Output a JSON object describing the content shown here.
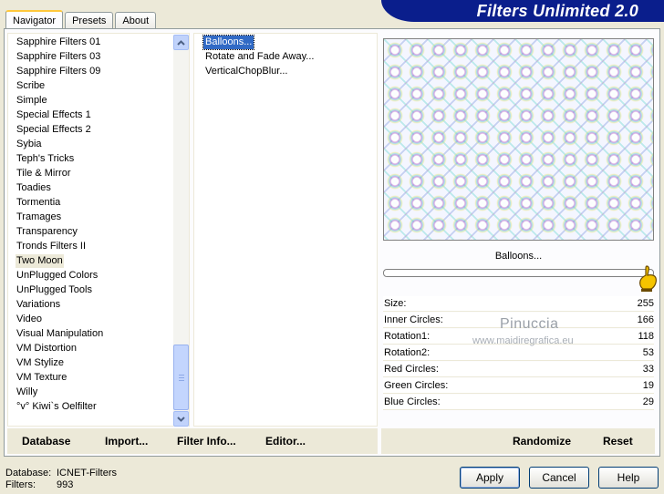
{
  "tabs": [
    {
      "label": "Navigator",
      "active": true
    },
    {
      "label": "Presets",
      "active": false
    },
    {
      "label": "About",
      "active": false
    }
  ],
  "banner": {
    "title": "Filters Unlimited 2.0"
  },
  "categories": [
    "Sapphire Filters 01",
    "Sapphire Filters 03",
    "Sapphire Filters 09",
    "Scribe",
    "Simple",
    "Special Effects 1",
    "Special Effects 2",
    "Sybia",
    "Teph's Tricks",
    "Tile & Mirror",
    "Toadies",
    "Tormentia",
    "Tramages",
    "Transparency",
    "Tronds Filters II",
    "Two Moon",
    "UnPlugged Colors",
    "UnPlugged Tools",
    "Variations",
    "Video",
    "Visual Manipulation",
    "VM Distortion",
    "VM Stylize",
    "VM Texture",
    "Willy",
    "°v° Kiwi`s Oelfilter"
  ],
  "selected_category": "Two Moon",
  "filters": [
    "Balloons...",
    "Rotate and Fade Away...",
    "VerticalChopBlur..."
  ],
  "selected_filter": "Balloons...",
  "preview_label": "Balloons...",
  "params": [
    {
      "label": "Size:",
      "value": "255"
    },
    {
      "label": "Inner Circles:",
      "value": "166"
    },
    {
      "label": "Rotation1:",
      "value": "118"
    },
    {
      "label": "Rotation2:",
      "value": "53"
    },
    {
      "label": "Red Circles:",
      "value": "33"
    },
    {
      "label": "Green Circles:",
      "value": "19"
    },
    {
      "label": "Blue Circles:",
      "value": "29"
    }
  ],
  "watermark": {
    "name": "Pinuccia",
    "url": "www.maidiregrafica.eu"
  },
  "left_buttons": [
    "Database",
    "Import...",
    "Filter Info...",
    "Editor..."
  ],
  "right_buttons": [
    "Randomize",
    "Reset"
  ],
  "status": {
    "database_label": "Database:",
    "database_value": "ICNET-Filters",
    "filters_label": "Filters:",
    "filters_value": "993"
  },
  "dialog_buttons": {
    "apply": "Apply",
    "cancel": "Cancel",
    "help": "Help"
  },
  "icons": {
    "scroll_up": "chevron-up-icon",
    "scroll_down": "chevron-down-icon",
    "pointer": "pointing-hand-icon"
  }
}
